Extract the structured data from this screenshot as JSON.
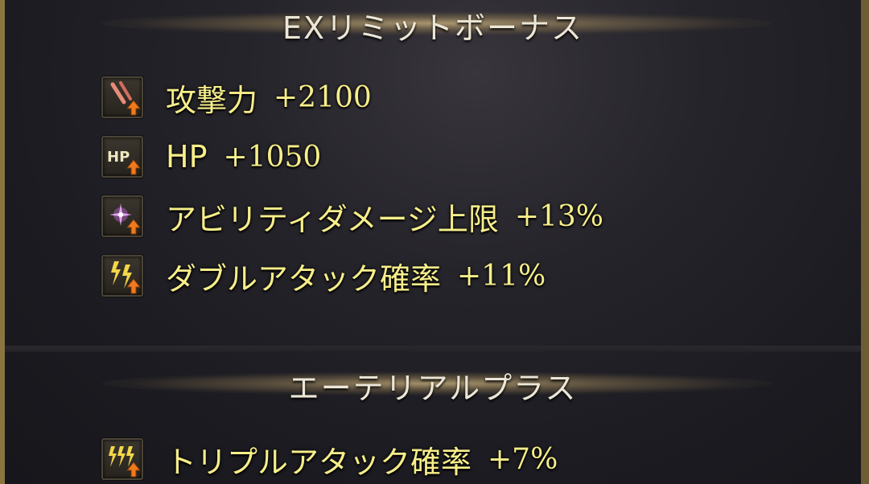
{
  "sections": [
    {
      "title": "EXリミットボーナス",
      "items": [
        {
          "icon": "sword-up-icon",
          "label": "攻撃力",
          "value": "+2100"
        },
        {
          "icon": "hp-up-icon",
          "label": "HP",
          "value": "+1050"
        },
        {
          "icon": "sparkle-up-icon",
          "label": "アビリティダメージ上限",
          "value": "+13%"
        },
        {
          "icon": "double-attack-up-icon",
          "label": "ダブルアタック確率",
          "value": "+11%"
        }
      ]
    },
    {
      "title": "エーテリアルプラス",
      "items": [
        {
          "icon": "triple-attack-up-icon",
          "label": "トリプルアタック確率",
          "value": "+7%"
        }
      ]
    }
  ],
  "colors": {
    "text_gold": "#f7ee8a",
    "title_text": "#ece6d6",
    "frame_gold": "#8a7440",
    "background": "#1a1a20"
  }
}
